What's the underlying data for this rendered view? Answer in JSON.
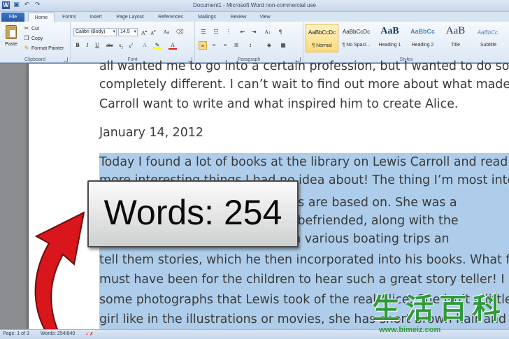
{
  "window": {
    "title": "Document1 - Microsoft Word non-commercial use"
  },
  "tabs": [
    {
      "label": "File"
    },
    {
      "label": "Home"
    },
    {
      "label": "Forms"
    },
    {
      "label": "Insert"
    },
    {
      "label": "Page Layout"
    },
    {
      "label": "References"
    },
    {
      "label": "Mailings"
    },
    {
      "label": "Review"
    },
    {
      "label": "View"
    }
  ],
  "clipboard": {
    "paste": "Paste",
    "cut": "Cut",
    "copy": "Copy",
    "format_painter": "Format Painter",
    "group_label": "Clipboard"
  },
  "font": {
    "name": "Calibri (Body)",
    "size": "14.5",
    "group_label": "Font"
  },
  "paragraph": {
    "group_label": "Paragraph"
  },
  "styles": {
    "group_label": "Styles",
    "items": [
      {
        "sample": "AaBbCcDc",
        "name": "¶ Normal"
      },
      {
        "sample": "AaBbCcDc",
        "name": "¶ No Spaci..."
      },
      {
        "sample": "AaB",
        "name": "Heading 1"
      },
      {
        "sample": "AaBbCc",
        "name": "Heading 2"
      },
      {
        "sample": "AaB",
        "name": "Title"
      },
      {
        "sample": "AaBbCc.",
        "name": "Subtitle"
      }
    ]
  },
  "document": {
    "lines": [
      "all wanted me to go into a certain profession, but I wanted to do somethi",
      "completely different. I can’t wait to find out more about what made Lewi",
      "Carroll want to write and what inspired him to create Alice.",
      "January 14, 2012",
      "Today I found a lot of books at the library on Lewis Carroll and read some",
      "more interesting things I had no idea about! The thing I’m most intereste",
      "is Alice books are based on. She was a",
      "n Lewis had befriended, along with the",
      "e children on various boating trips an",
      "tell them stories, which he then incorporated into his books. What fun th",
      "must have been for the children to hear such a great story teller! I also sa",
      "some photographs that Lewis took of the real Alice. She isn’t a little blon",
      "girl like in the illustrations or movies, she has short brown hair and dark"
    ]
  },
  "callout": {
    "text": "Words: 254"
  },
  "status": {
    "page": "Page: 1 of 3",
    "words": "Words: 254/840"
  },
  "watermark": {
    "url": "www.bimeiz.com"
  },
  "colors": {
    "selection": "#aecdea",
    "arrow": "#d8161c",
    "file_tab": "#2a5aa8"
  }
}
